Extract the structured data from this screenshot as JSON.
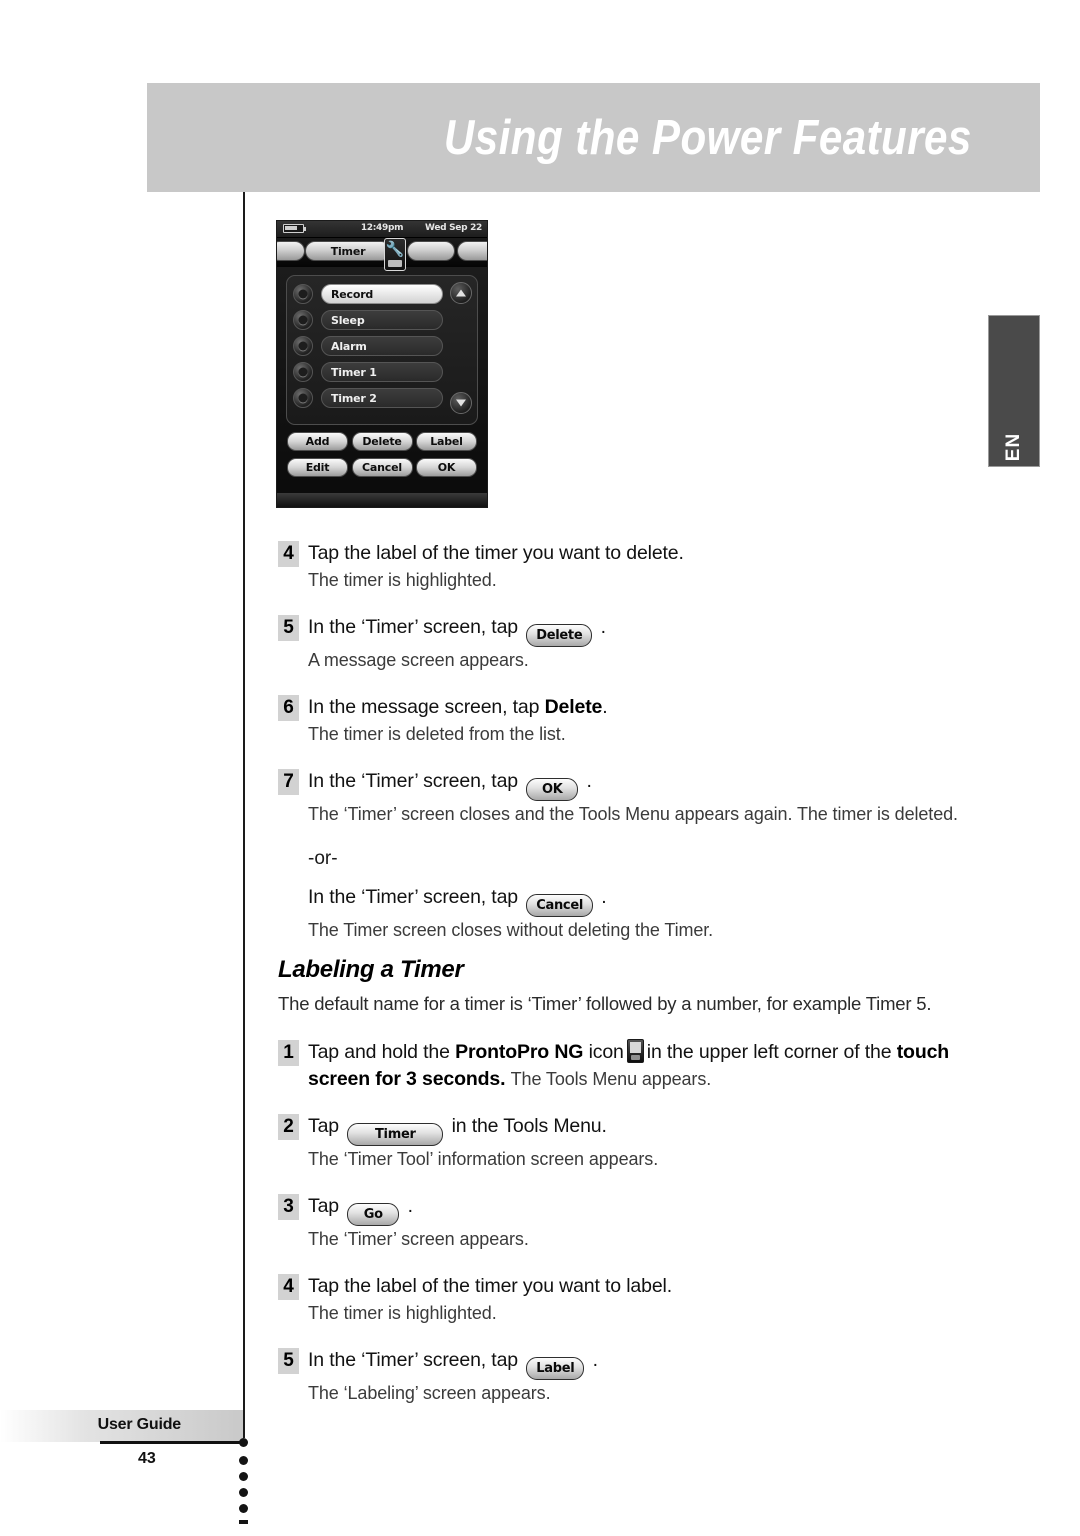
{
  "header": {
    "title": "Using the Power Features"
  },
  "language_tab": {
    "label": "EN"
  },
  "device_screenshot": {
    "status_bar": {
      "battery_icon": "battery-icon",
      "time": "12:49pm",
      "home_icon": "prontopro-device-wrench-icon",
      "date": "Wed Sep 22"
    },
    "tab_label": "Timer",
    "list_items": [
      {
        "label": "Record",
        "selected": true
      },
      {
        "label": "Sleep",
        "selected": false
      },
      {
        "label": "Alarm",
        "selected": false
      },
      {
        "label": "Timer 1",
        "selected": false
      },
      {
        "label": "Timer 2",
        "selected": false
      }
    ],
    "scroll_up_icon": "scroll-up-icon",
    "scroll_down_icon": "scroll-down-icon",
    "buttons_row1": [
      "Add",
      "Delete",
      "Label"
    ],
    "buttons_row2": [
      "Edit",
      "Cancel",
      "OK"
    ]
  },
  "steps_delete": [
    {
      "number": "4",
      "main_prefix": "Tap the label of the timer you want to delete.",
      "sub": "The timer is highlighted."
    },
    {
      "number": "5",
      "main_prefix": "In the ‘Timer’ screen, tap",
      "button": "Delete",
      "main_suffix": ".",
      "sub": "A message screen appears."
    },
    {
      "number": "6",
      "main_prefix": "In the message screen, tap",
      "bold_text": "Delete",
      "main_suffix": ".",
      "sub": "The timer is deleted from the list."
    },
    {
      "number": "7",
      "main_prefix": "In the ‘Timer’ screen, tap",
      "button": "OK",
      "main_suffix": ".",
      "sub": "The ‘Timer’ screen closes and the Tools Menu appears again. The timer is deleted."
    }
  ],
  "or_section": {
    "or_label": "-or-",
    "main_prefix": "In the ‘Timer’ screen, tap",
    "button": "Cancel",
    "main_suffix": ".",
    "sub": "The Timer screen closes without deleting the Timer."
  },
  "section": {
    "heading": "Labeling a Timer",
    "intro": "The default name for a timer is ‘Timer’ followed by a number, for example Timer 5."
  },
  "steps_label": [
    {
      "number": "1",
      "part1": "Tap and hold the",
      "bold1": "ProntoPro NG",
      "part2": "icon",
      "icon": "prontopro-device-icon",
      "part3": "in the upper left corner of the",
      "bold2": "touch screen for 3 seconds.",
      "sub": "The Tools Menu appears."
    },
    {
      "number": "2",
      "main_prefix": "Tap",
      "button": "Timer",
      "main_suffix": "in the Tools Menu.",
      "sub": "The ‘Timer Tool’ information screen appears."
    },
    {
      "number": "3",
      "main_prefix": "Tap",
      "button": "Go",
      "main_suffix": ".",
      "sub": "The ‘Timer’ screen appears."
    },
    {
      "number": "4",
      "main_prefix": "Tap the label of the timer you want to label.",
      "sub": "The timer is highlighted."
    },
    {
      "number": "5",
      "main_prefix": "In the ‘Timer’ screen, tap",
      "button": "Label",
      "main_suffix": ".",
      "sub": "The ‘Labeling’ screen appears."
    }
  ],
  "footer": {
    "label": "User Guide",
    "page_number": "43"
  },
  "colors": {
    "header_band": "#c8c8c8",
    "step_number_bg": "#d2d2d2",
    "language_tab_bg": "#4a4a4a"
  }
}
